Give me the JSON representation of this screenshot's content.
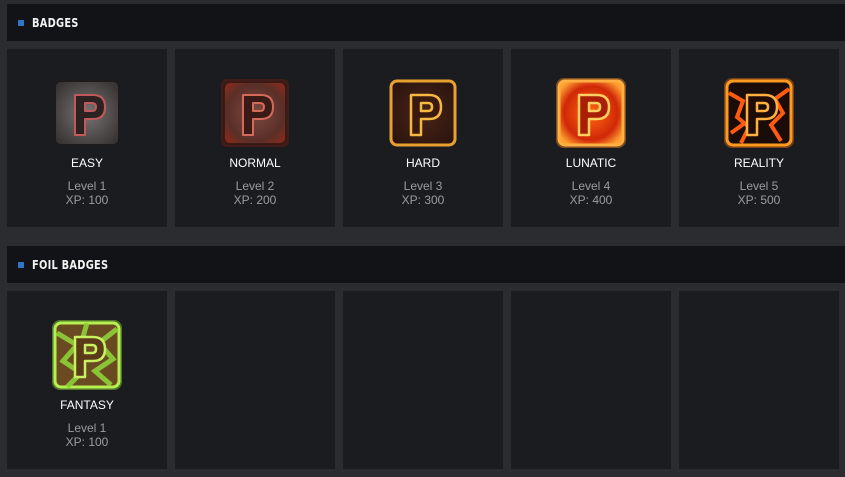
{
  "sections": [
    {
      "title": "BADGES",
      "badges": [
        {
          "name": "EASY",
          "level": "Level 1",
          "xp": "XP: 100",
          "icon": "p-badge-stone-icon"
        },
        {
          "name": "NORMAL",
          "level": "Level 2",
          "xp": "XP: 200",
          "icon": "p-badge-ember-icon"
        },
        {
          "name": "HARD",
          "level": "Level 3",
          "xp": "XP: 300",
          "icon": "p-badge-glowing-icon"
        },
        {
          "name": "LUNATIC",
          "level": "Level 4",
          "xp": "XP: 400",
          "icon": "p-badge-lava-icon"
        },
        {
          "name": "REALITY",
          "level": "Level 5",
          "xp": "XP: 500",
          "icon": "p-badge-cracked-lava-icon"
        }
      ]
    },
    {
      "title": "FOIL BADGES",
      "badges": [
        {
          "name": "FANTASY",
          "level": "Level 1",
          "xp": "XP: 100",
          "icon": "p-badge-foil-green-icon"
        }
      ]
    }
  ],
  "colors": {
    "page_bg": "#2a2c30",
    "header_bg": "#121316",
    "card_bg": "#1b1c20",
    "accent": "#2f74c6",
    "name_text": "#ffffff",
    "meta_text": "#9a9ca2"
  }
}
